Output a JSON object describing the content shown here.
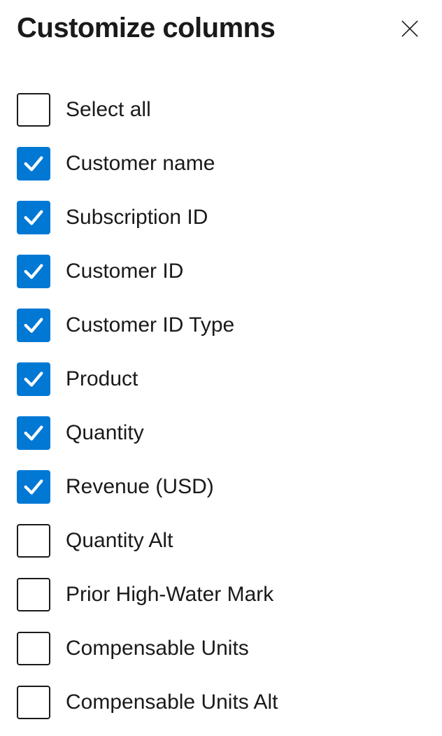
{
  "header": {
    "title": "Customize columns"
  },
  "options": [
    {
      "id": "select-all",
      "label": "Select all",
      "checked": false
    },
    {
      "id": "customer-name",
      "label": "Customer name",
      "checked": true
    },
    {
      "id": "subscription-id",
      "label": "Subscription ID",
      "checked": true
    },
    {
      "id": "customer-id",
      "label": "Customer ID",
      "checked": true
    },
    {
      "id": "customer-id-type",
      "label": "Customer ID Type",
      "checked": true
    },
    {
      "id": "product",
      "label": "Product",
      "checked": true
    },
    {
      "id": "quantity",
      "label": "Quantity",
      "checked": true
    },
    {
      "id": "revenue-usd",
      "label": "Revenue (USD)",
      "checked": true
    },
    {
      "id": "quantity-alt",
      "label": "Quantity Alt",
      "checked": false
    },
    {
      "id": "prior-high-water-mark",
      "label": "Prior High-Water Mark",
      "checked": false
    },
    {
      "id": "compensable-units",
      "label": "Compensable Units",
      "checked": false
    },
    {
      "id": "compensable-units-alt",
      "label": "Compensable Units Alt",
      "checked": false
    }
  ],
  "colors": {
    "accent": "#0078d4"
  }
}
